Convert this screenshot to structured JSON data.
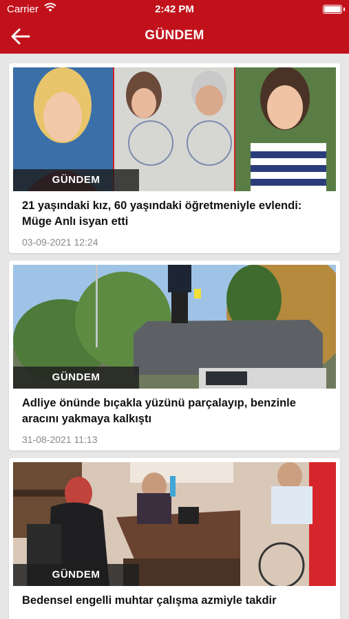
{
  "status_bar": {
    "carrier": "Carrier",
    "time": "2:42 PM",
    "wifi_icon": "wifi-icon",
    "battery_icon": "battery-icon"
  },
  "nav": {
    "title": "GÜNDEM",
    "back_icon": "back-arrow-icon"
  },
  "accent_color": "#c1121c",
  "articles": [
    {
      "category": "GÜNDEM",
      "title": "21 yaşındaki kız, 60 yaşındaki öğretmeniyle evlendi: Müge Anlı isyan etti",
      "date": "03-09-2021 12:24"
    },
    {
      "category": "GÜNDEM",
      "title": "Adliye önünde bıçakla yüzünü parçalayıp, benzinle aracını yakmaya kalkıştı",
      "date": "31-08-2021 11:13"
    },
    {
      "category": "GÜNDEM",
      "title": "Bedensel engelli muhtar çalışma azmiyle takdir"
    }
  ]
}
